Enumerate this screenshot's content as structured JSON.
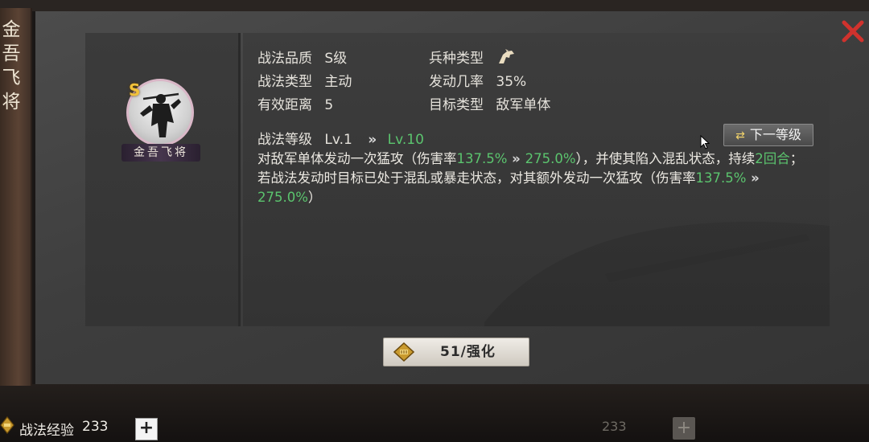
{
  "side_title": "金吾飞将",
  "skill": {
    "name": "金吾飞将",
    "grade_badge": "S",
    "quality_label": "战法品质",
    "quality_value": "S级",
    "type_label": "战法类型",
    "type_value": "主动",
    "range_label": "有效距离",
    "range_value": "5",
    "troop_label": "兵种类型",
    "troop_icon": "cavalry-horse-icon",
    "rate_label": "发动几率",
    "rate_value": "35%",
    "target_label": "目标类型",
    "target_value": "敌军单体",
    "level_label": "战法等级",
    "level_current": "Lv.1",
    "level_arrow": "»",
    "level_max": "Lv.10",
    "next_level_button": "下一等级",
    "desc": {
      "p1": "对敌军单体发动一次猛攻（伤害率",
      "v1": "137.5%",
      "arrow1": " » ",
      "v2": "275.0%",
      "p2": "），并使其陷入混乱状态，持续",
      "v3": "2回合",
      "p3": "；若战法发动时目标已处于混乱或暴走状态，对其额外发动一次猛攻（伤害率",
      "v4": "137.5%",
      "arrow2": " » ",
      "v5": "275.0%",
      "p4": "）"
    }
  },
  "upgrade_button": "51/强化",
  "footer": {
    "exp_label": "战法经验",
    "exp_value": "233",
    "plus": "+",
    "faint_value": "233"
  },
  "colors": {
    "accent_green": "#5bc46e",
    "close_red": "#d0322d",
    "grade_gold": "#f2c23a"
  }
}
